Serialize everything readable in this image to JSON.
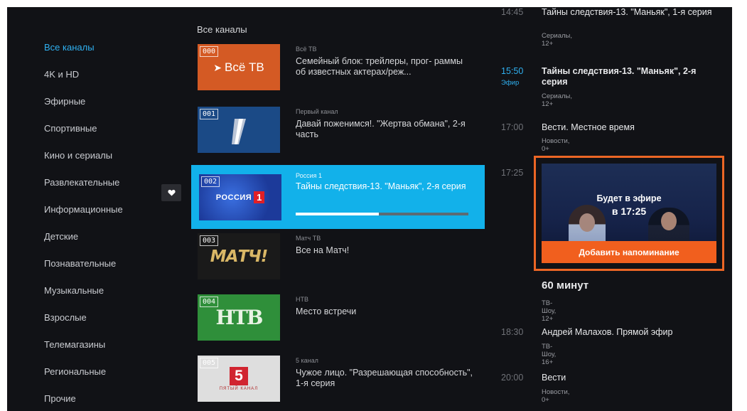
{
  "categories": [
    {
      "label": "Все каналы",
      "active": true
    },
    {
      "label": "4K и HD"
    },
    {
      "label": "Эфирные"
    },
    {
      "label": "Спортивные"
    },
    {
      "label": "Кино и сериалы"
    },
    {
      "label": "Развлекательные"
    },
    {
      "label": "Информационные"
    },
    {
      "label": "Детские"
    },
    {
      "label": "Познавательные"
    },
    {
      "label": "Музыкальные"
    },
    {
      "label": "Взрослые"
    },
    {
      "label": "Телемагазины"
    },
    {
      "label": "Региональные"
    },
    {
      "label": "Прочие"
    }
  ],
  "favorite_icon": "heart-icon",
  "channels_title": "Все каналы",
  "channels": [
    {
      "num": "000",
      "logo_text": "Всё ТВ",
      "name": "Всё ТВ",
      "show": "Семейный блок: трейлеры, прог- раммы об известных актерах/реж..."
    },
    {
      "num": "001",
      "logo_text": "1",
      "name": "Первый канал",
      "show": "Давай поженимся!. \"Жертва обмана\", 2-я часть"
    },
    {
      "num": "002",
      "logo_text": "РОССИЯ",
      "logo_num": "1",
      "name": "Россия 1",
      "show": "Тайны следствия-13. \"Маньяк\", 2-я серия",
      "progress": 0.48
    },
    {
      "num": "003",
      "logo_text": "МАТЧ!",
      "name": "Матч ТВ",
      "show": "Все на Матч!"
    },
    {
      "num": "004",
      "logo_text": "НТВ",
      "name": "НТВ",
      "show": "Место встречи"
    },
    {
      "num": "005",
      "logo_text": "5",
      "logo_sub": "ПЯТЫЙ КАНАЛ",
      "name": "5 канал",
      "show": "Чужое лицо. \"Разрешающая способность\", 1-я серия"
    }
  ],
  "schedule": [
    {
      "time": "14:45",
      "title": "Тайны следствия-13. \"Маньяк\", 1-я серия",
      "genre": "Сериалы, 12+"
    },
    {
      "time": "15:50",
      "badge": "Эфир",
      "title": "Тайны следствия-13. \"Маньяк\", 2-я серия",
      "genre": "Сериалы, 12+"
    },
    {
      "time": "17:00",
      "title": "Вести. Местное время",
      "genre": "Новости, 0+"
    },
    {
      "time": "17:25",
      "title": "60 минут",
      "genre": "ТВ-Шоу, 12+"
    },
    {
      "time": "18:30",
      "title": "Андрей Малахов. Прямой эфир",
      "genre": "ТВ-Шоу, 16+"
    },
    {
      "time": "20:00",
      "title": "Вести",
      "genre": "Новости, 0+"
    }
  ],
  "reminder": {
    "line1": "Будет в эфире",
    "line2": "в 17:25",
    "button": "Добавить напоминание"
  },
  "colors": {
    "accent_blue": "#12b1ea",
    "accent_orange": "#f15f1e",
    "background": "#111216"
  }
}
